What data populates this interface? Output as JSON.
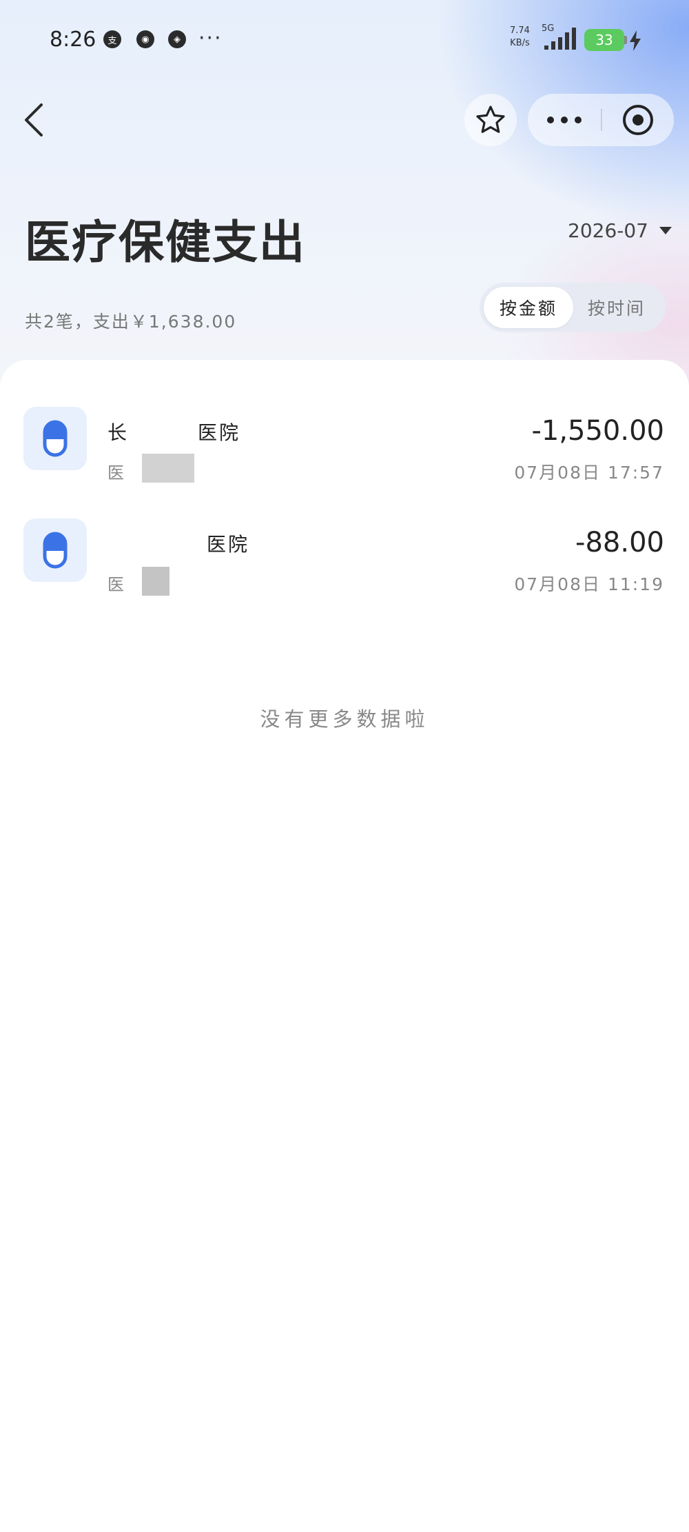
{
  "status_bar": {
    "time": "8:26",
    "notification_icons": [
      {
        "icon": "alipay-notif-icon",
        "glyph": "支"
      },
      {
        "icon": "app-notif-icon",
        "glyph": "◉"
      },
      {
        "icon": "app-notif-icon-2",
        "glyph": "◈"
      }
    ],
    "more": "···",
    "net_speed_value": "7.74",
    "net_speed_unit": "KB/s",
    "network": "5G",
    "battery": "33"
  },
  "nav": {
    "back_icon": "chevron-left-icon",
    "favorite_icon": "star-icon",
    "more_icon": "more-dots-icon",
    "close_icon": "target-icon"
  },
  "header": {
    "title": "医疗保健支出",
    "month": "2026-07",
    "summary": "共2笔，支出￥1,638.00",
    "sort_tabs": [
      {
        "label": "按金额",
        "active": true
      },
      {
        "label": "按时间",
        "active": false
      }
    ]
  },
  "records": [
    {
      "name_prefix": "长",
      "name_suffix": "医院",
      "sub": "医",
      "amount": "-1,550.00",
      "time": "07月08日  17:57",
      "icon": "medicine-capsule-icon"
    },
    {
      "name_prefix": "",
      "name_suffix": "医院",
      "sub": "医",
      "amount": "-88.00",
      "time": "07月08日  11:19",
      "icon": "medicine-capsule-icon"
    }
  ],
  "footer": {
    "no_more": "没有更多数据啦"
  },
  "colors": {
    "accent": "#3b73e6",
    "icon_bg": "#e8f0fd",
    "battery": "#5ccb5f"
  }
}
